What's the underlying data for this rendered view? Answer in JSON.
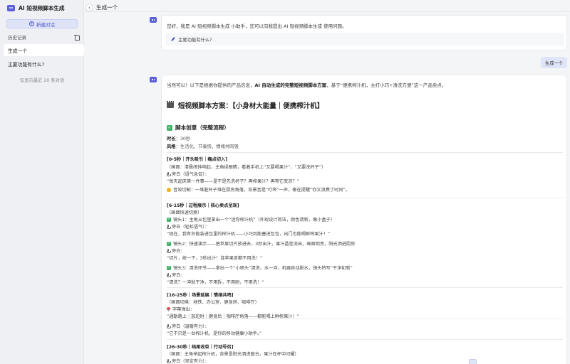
{
  "sidebar": {
    "brand_title": "AI 短视频脚本生成",
    "new_chat_label": "新建对话",
    "history_label": "历史记录",
    "history_items": [
      {
        "label": "生成一个"
      },
      {
        "label": "主要功能有什么?"
      }
    ],
    "history_note": "仅显示最近 20 条对话"
  },
  "main": {
    "title": "生成一个",
    "greeting": "您好，我是 AI 短视频脚本生成 小助手，您可以向我提出 AI 短视频脚本生成 使用问题。",
    "suggestion": "主要功能有什么?",
    "user_message": "生成一个",
    "answer": {
      "intro_before": "当然可以！以下是根据你提供的产品信息，",
      "intro_bold": "AI 自动生成的完整短视频脚本方案",
      "intro_after": "，基于“便携榨汁机，主打小巧+清洗方便”这一产品卖点。",
      "heading": "短视频脚本方案：【小身材大能量｜便携榨汁机】",
      "section_title": "脚本创意（完整流程）",
      "duration_label": "时长",
      "duration_value": "：30秒",
      "style_label": "风格",
      "style_value": "：生活化、节奏快、情绪共鸣强",
      "lines": [
        {
          "text": "[0-5秒｜开头吸引｜痛点切入]",
          "kind": "head",
          "icon": ""
        },
        {
          "text": "（画面：清晨闹钟响起，主角揉眼睛，看着手机上“又要喝果汁”、“又要洗杯子”）",
          "kind": "normal",
          "icon": ""
        },
        {
          "text": "旁白（语气急促）：",
          "kind": "normal",
          "icon": "mic-icon"
        },
        {
          "text": "“每天起床第一件事——是不是先洗杯子？再榨果汁？再等它变凉？”",
          "kind": "normal",
          "icon": ""
        },
        {
          "text": "音效切割：一堆脏杯子堆在厨房角落，背景音是“叮咚”一声，像在提醒“你又浪费了时间”。",
          "kind": "normal",
          "icon": "hand-icon"
        },
        {
          "text": "[6-15秒｜过程展示｜核心卖点呈现]",
          "kind": "head",
          "icon": ""
        },
        {
          "text": "（画面快速切换）",
          "kind": "normal",
          "icon": ""
        },
        {
          "text": "镜头1：主角从包里拿出一个“迷你榨汁机”（外观设计简洁，颜色清新，像小盒子）",
          "kind": "normal",
          "icon": "check-icon"
        },
        {
          "text": "旁白（轻松语气）：",
          "kind": "normal",
          "icon": "mic-icon"
        },
        {
          "text": "“现在，我有台能装进包里的榨汁机——小巧到能塞进包包，出门也能喝鲜榨果汁！”",
          "kind": "normal",
          "icon": ""
        },
        {
          "text": "镜头2：快速演示——把苹果切片放进去，3秒出汁，果汁晶莹流出，画面明亮，阳光洒进厨房",
          "kind": "normal",
          "icon": "check-icon"
        },
        {
          "text": "旁白：",
          "kind": "normal",
          "icon": "mic-icon"
        },
        {
          "text": "“切片，按一下，3秒出汁！连苹果皮都不用洗！”",
          "kind": "normal",
          "icon": ""
        },
        {
          "text": "镜头3：清洗环节——拿出一个“小喷头”清洗，水一冲，机器自动脱水，镜头特写“干净如新”",
          "kind": "normal",
          "icon": "check-icon"
        },
        {
          "text": "旁白：",
          "kind": "normal",
          "icon": "mic-icon"
        },
        {
          "text": "“清洗？一冲就干净，不用拆，不用刷，不用洗！”",
          "kind": "normal",
          "icon": ""
        },
        {
          "text": "[16-25秒｜场景延展｜情绪共鸣]",
          "kind": "head",
          "icon": ""
        },
        {
          "text": "（画面切换：地铁、办公室、健身房、咖啡厅）",
          "kind": "normal",
          "icon": ""
        },
        {
          "text": "字幕弹出：",
          "kind": "normal",
          "icon": "pin-icon"
        },
        {
          "text": "“通勤路上｜加班时｜健身后｜咖啡厅角落——都能喝上鲜榨果汁！”",
          "kind": "normal",
          "icon": ""
        },
        {
          "text": "旁白（温暖有力）：",
          "kind": "normal",
          "icon": "mic-icon"
        },
        {
          "text": "“它不只是一台榨汁机，是你的移动健康小助手。”",
          "kind": "normal",
          "icon": ""
        },
        {
          "text": "[26-30秒｜结尾收束｜行动号召]",
          "kind": "head",
          "icon": ""
        },
        {
          "text": "（画面：主角举起榨汁机，背景是阳光洒进窗台，果汁在杯中闪耀）",
          "kind": "normal",
          "icon": ""
        },
        {
          "text": "旁白（坚定有力）：",
          "kind": "normal",
          "icon": "mic-icon"
        }
      ]
    }
  }
}
